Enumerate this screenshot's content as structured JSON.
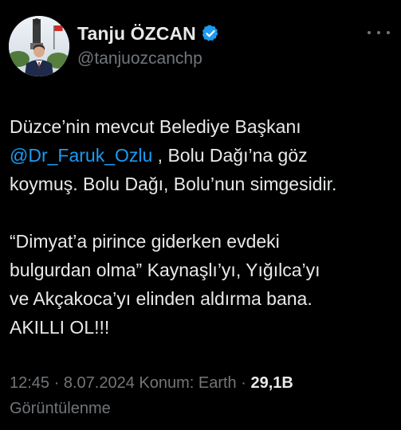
{
  "author": {
    "display_name": "Tanju ÖZCAN",
    "handle": "@tanjuozcanchp",
    "verified_color": "#1d9bf0",
    "avatar_icon": "avatar-photo",
    "more_icon": "more-dots-icon"
  },
  "tweet": {
    "line1": "Düzce’nin mevcut Belediye Başkanı",
    "mention": "@Dr_Faruk_Ozlu",
    "line2_rest": " , Bolu Dağı’na göz",
    "line3": "koymuş. Bolu Dağı, Bolu’nun simgesidir.",
    "line4": "“Dimyat’a pirince giderken evdeki",
    "line5": "bulgurdan olma” Kaynaşlı’yı, Yığılca’yı",
    "line6": "ve Akçakoca’yı elinden aldırma bana.",
    "line7": "AKILLI OL!!!"
  },
  "meta": {
    "time": "12:45",
    "separator": " · ",
    "date": "8.07.2024",
    "location": " Konum: Earth",
    "separator2": " · ",
    "views_count": "29,1B",
    "views_label": "Görüntülenme"
  },
  "colors": {
    "background": "#000000",
    "text": "#e7e9ea",
    "secondary": "#71767b",
    "link": "#1d9bf0"
  }
}
